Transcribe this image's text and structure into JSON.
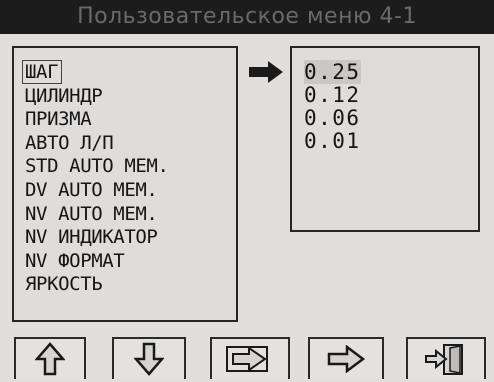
{
  "header": {
    "title": "Пользовательское меню 4-1"
  },
  "menu": {
    "items": [
      {
        "label": "ШАГ",
        "selected": true
      },
      {
        "label": "ЦИЛИНДР",
        "selected": false
      },
      {
        "label": "ПРИЗМА",
        "selected": false
      },
      {
        "label": "АВТО Л/П",
        "selected": false
      },
      {
        "label": "STD AUTO MEM.",
        "selected": false
      },
      {
        "label": "DV AUTO MEM.",
        "selected": false
      },
      {
        "label": "NV AUTO MEM.",
        "selected": false
      },
      {
        "label": "NV ИНДИКАТОР",
        "selected": false
      },
      {
        "label": "NV ФОРМАТ",
        "selected": false
      },
      {
        "label": "ЯРКОСТЬ",
        "selected": false
      }
    ]
  },
  "values": {
    "options": [
      "0.25",
      "0.12",
      "0.06",
      "0.01"
    ],
    "selected_index": 0
  },
  "buttons": {
    "up": {
      "icon": "arrow-up-icon"
    },
    "down": {
      "icon": "arrow-down-icon"
    },
    "enter": {
      "icon": "enter-arrow-icon"
    },
    "next": {
      "icon": "arrow-right-icon"
    },
    "exit": {
      "icon": "exit-door-icon"
    }
  },
  "colors": {
    "title_bar": "#1c1c1c",
    "title_text": "#6a6a6a",
    "panel_bg": "#dedddb",
    "text": "#151515"
  }
}
